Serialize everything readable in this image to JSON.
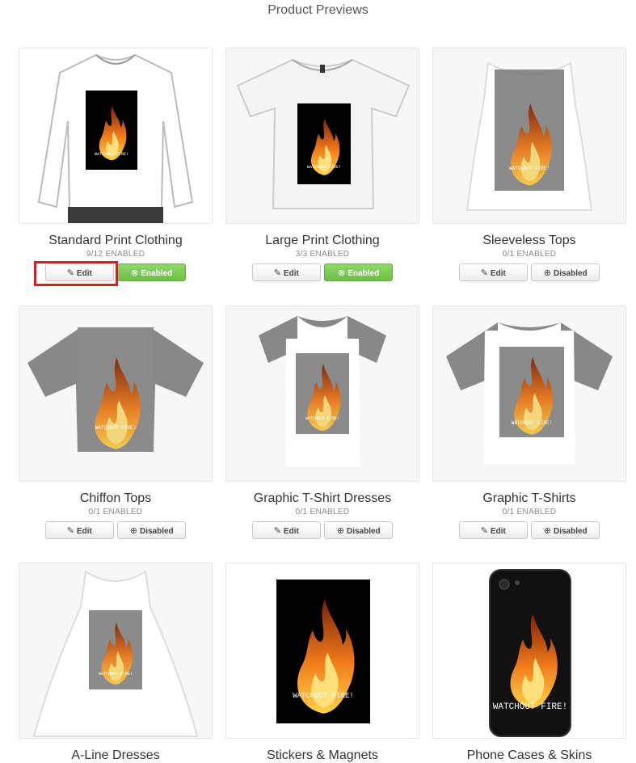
{
  "header": {
    "title": "Product Previews"
  },
  "design_text": "WATCHOUT FIRE!",
  "colors": {
    "enabled_green": "#6cbf48",
    "highlight_red": "#e01b24",
    "flame": "#e8701a"
  },
  "icons": {
    "edit": "edit-icon",
    "enabled": "check-circle-icon",
    "disabled": "plus-circle-icon"
  },
  "products": [
    {
      "title": "Standard Print Clothing",
      "count": "9/12 ENABLED",
      "edit_label": "Edit",
      "status_label": "Enabled",
      "status": "enabled",
      "highlighted": true
    },
    {
      "title": "Large Print Clothing",
      "count": "3/3 ENABLED",
      "edit_label": "Edit",
      "status_label": "Enabled",
      "status": "enabled"
    },
    {
      "title": "Sleeveless Tops",
      "count": "0/1 ENABLED",
      "edit_label": "Edit",
      "status_label": "Disabled",
      "status": "disabled"
    },
    {
      "title": "Chiffon Tops",
      "count": "0/1 ENABLED",
      "edit_label": "Edit",
      "status_label": "Disabled",
      "status": "disabled"
    },
    {
      "title": "Graphic T-Shirt Dresses",
      "count": "0/1 ENABLED",
      "edit_label": "Edit",
      "status_label": "Disabled",
      "status": "disabled"
    },
    {
      "title": "Graphic T-Shirts",
      "count": "0/1 ENABLED",
      "edit_label": "Edit",
      "status_label": "Disabled",
      "status": "disabled"
    },
    {
      "title": "A-Line Dresses"
    },
    {
      "title": "Stickers & Magnets"
    },
    {
      "title": "Phone Cases & Skins"
    }
  ]
}
